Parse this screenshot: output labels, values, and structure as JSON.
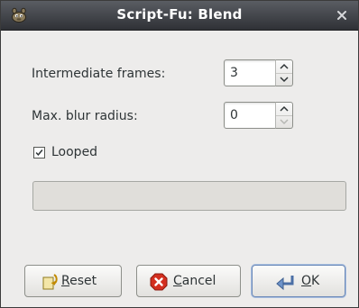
{
  "window": {
    "title": "Script-Fu: Blend"
  },
  "fields": {
    "intermediate_frames": {
      "label": "Intermediate frames:",
      "value": "3"
    },
    "max_blur_radius": {
      "label": "Max. blur radius:",
      "value": "0"
    }
  },
  "looped": {
    "label": "Looped",
    "checked": true
  },
  "progress": {
    "fraction": 0
  },
  "buttons": {
    "reset": {
      "mnemonic": "R",
      "rest": "eset",
      "icon": "reset-icon"
    },
    "cancel": {
      "mnemonic": "C",
      "rest": "ancel",
      "icon": "cancel-icon"
    },
    "ok": {
      "mnemonic": "O",
      "rest": "K",
      "icon": "ok-icon"
    }
  },
  "colors": {
    "titlebar": "#3b3e44",
    "cancel_red": "#d32f1f",
    "ok_focus": "#6b89b8"
  }
}
